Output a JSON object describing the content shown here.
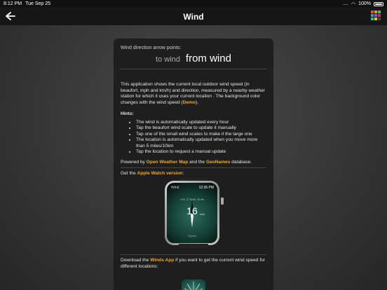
{
  "status": {
    "time": "8:12 PM",
    "date": "Tue Sep 25",
    "signal": "....",
    "battery": "100%"
  },
  "nav": {
    "title": "Wind"
  },
  "colors": {
    "accent": "#f5a623",
    "grid": [
      "#e84b3c",
      "#f39c12",
      "#2ecc71",
      "#3498db",
      "#9b59b6",
      "#e91e63",
      "#1abc9c",
      "#f1c40f",
      "#34495e"
    ]
  },
  "card": {
    "direction_label": "Wind direction arrow points:",
    "option_to": "to wind",
    "option_from": "from wind",
    "desc_part1": "This application shows the current local outdoor wind speed (in beaufort, mph and km/h) and direction, measured by a nearby weather station for which it uses your current location . The background color changes with the wind speed (",
    "demo_link": "Demo",
    "desc_part2": ").",
    "hints_title": "Hints:",
    "hints": [
      "The wind is automatically updated every hour",
      "Tap the beaufort wind scale to update it manually",
      "Tap one of the small wind scales to make it the large one",
      "The location is automatically updated when you move more than 5 miles/10km",
      "Tap the location to request a manual update"
    ],
    "powered_prefix": "Powered by ",
    "owm_link": "Open Weather Map",
    "and_text": " and the ",
    "geonames_link": "GeoNames",
    "powered_suffix": " database.",
    "watch_prefix": "Get the ",
    "watch_link": "Apple Watch version",
    "watch_suffix": ":",
    "download_prefix": "Download the ",
    "winds_link": "Winds App",
    "download_suffix": " if you want to get the current wind speed for different locations:"
  },
  "watch": {
    "app_name": "Wind",
    "time": "12:36 PM",
    "date": "4:09, 27 North, 3b Ms",
    "speed": "16",
    "unit": "mph",
    "direction": "S",
    "city": "Sydney"
  }
}
